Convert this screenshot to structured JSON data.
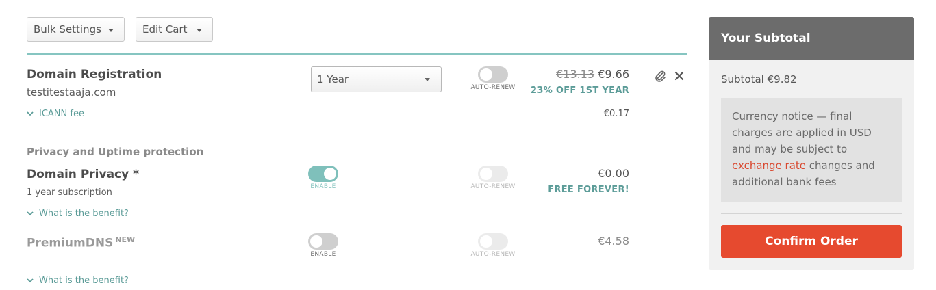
{
  "toolbar": {
    "bulk_settings": "Bulk Settings",
    "edit_cart": "Edit Cart"
  },
  "domain": {
    "title": "Domain Registration",
    "name": "testitestaaja.com",
    "period": "1 Year",
    "auto_renew_label": "AUTO-RENEW",
    "old_price": "€13.13",
    "price": "€9.66",
    "promo": "23% OFF 1ST YEAR",
    "icann_label": "ICANN fee",
    "icann_price": "€0.17"
  },
  "privacy_section": {
    "heading": "Privacy and Uptime protection"
  },
  "domain_privacy": {
    "title": "Domain Privacy *",
    "subtitle": "1 year subscription",
    "enable_label": "ENABLE",
    "auto_renew_label": "AUTO-RENEW",
    "price": "€0.00",
    "promo": "FREE FOREVER!",
    "benefit_link": "What is the benefit?",
    "enabled": true,
    "auto_renew": false
  },
  "premium_dns": {
    "title": "PremiumDNS",
    "badge": "NEW",
    "enable_label": "ENABLE",
    "auto_renew_label": "AUTO-RENEW",
    "price": "€4.58",
    "benefit_link": "What is the benefit?",
    "enabled": false,
    "auto_renew": false
  },
  "summary": {
    "header": "Your Subtotal",
    "subtotal": "Subtotal €9.82",
    "notice_before": "Currency notice — final charges are applied in USD and may be subject to ",
    "notice_link": "exchange rate",
    "notice_after": " changes and additional bank fees",
    "confirm": "Confirm Order"
  },
  "colors": {
    "teal": "#5c9c98",
    "toggle_on": "#7fc0bb",
    "confirm": "#e64a2f",
    "header_gray": "#6c6c6c"
  },
  "icons": [
    "chevron-down-icon",
    "paperclip-icon",
    "close-icon"
  ]
}
